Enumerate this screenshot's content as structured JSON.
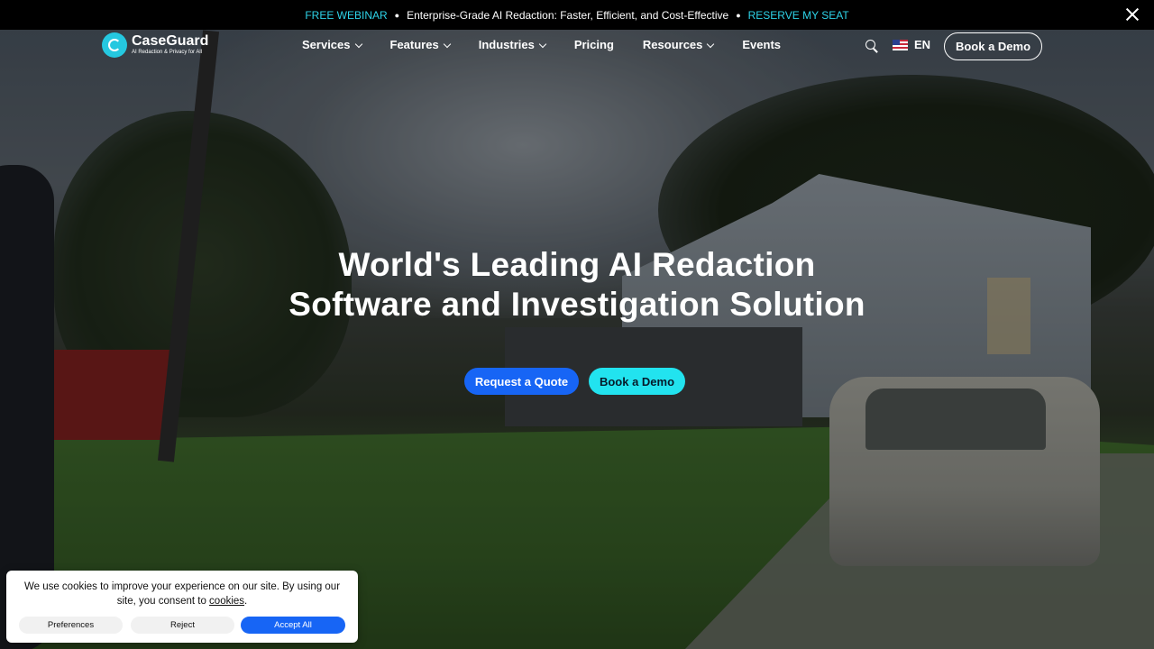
{
  "announcement": {
    "label": "FREE WEBINAR",
    "message": "Enterprise-Grade AI Redaction: Faster, Efficient, and Cost-Effective",
    "cta": "RESERVE MY SEAT",
    "separator": "●",
    "accent_color": "#2ed3e8"
  },
  "brand": {
    "name": "CaseGuard",
    "tagline": "AI Redaction & Privacy for All",
    "color": "#25c8e0"
  },
  "nav": {
    "items": [
      {
        "label": "Services",
        "dropdown": true
      },
      {
        "label": "Features",
        "dropdown": true
      },
      {
        "label": "Industries",
        "dropdown": true
      },
      {
        "label": "Pricing",
        "dropdown": false
      },
      {
        "label": "Resources",
        "dropdown": true
      },
      {
        "label": "Events",
        "dropdown": false
      }
    ],
    "language": "EN",
    "demo_button": "Book a Demo"
  },
  "hero": {
    "title_line1": "World's Leading AI Redaction",
    "title_line2": "Software and Investigation Solution",
    "quote_button": "Request a Quote",
    "demo_button": "Book a Demo",
    "quote_color": "#1765f5",
    "demo_color": "#22e3ef"
  },
  "cookie": {
    "text_before": "We use cookies to improve your experience on our site. By using our site, you consent to ",
    "link": "cookies",
    "text_after": ".",
    "preferences": "Preferences",
    "reject": "Reject",
    "accept": "Accept All"
  }
}
